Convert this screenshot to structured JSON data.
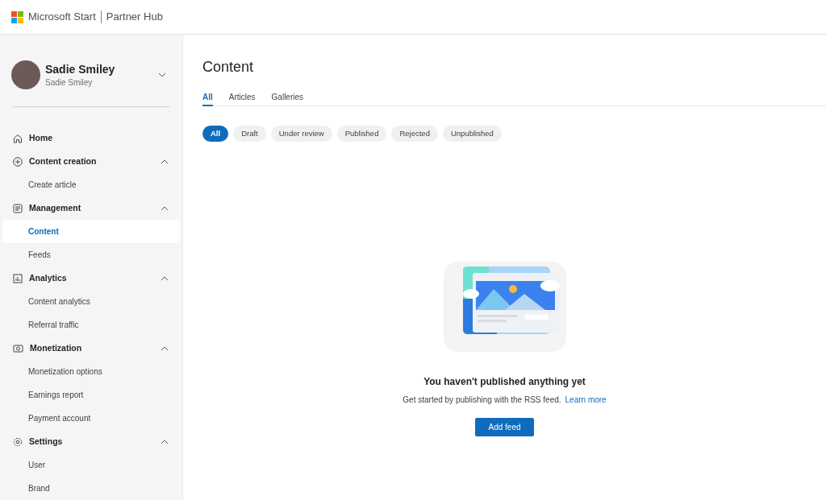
{
  "header": {
    "brand": "Microsoft Start",
    "product": "Partner Hub"
  },
  "profile": {
    "name": "Sadie Smiley",
    "subtitle": "Sadie Smiley",
    "expanded": false
  },
  "nav": [
    {
      "kind": "link",
      "label": "Home",
      "selected": false
    },
    {
      "kind": "group",
      "label": "Content creation",
      "selected": false,
      "expanded": true,
      "children": [
        {
          "label": "Create article",
          "selected": false
        }
      ]
    },
    {
      "kind": "group",
      "label": "Management",
      "selected": false,
      "expanded": true,
      "children": [
        {
          "label": "Content",
          "selected": true
        },
        {
          "label": "Feeds",
          "selected": false
        }
      ]
    },
    {
      "kind": "group",
      "label": "Analytics",
      "selected": false,
      "expanded": true,
      "children": [
        {
          "label": "Content analytics",
          "selected": false
        },
        {
          "label": "Referral traffic",
          "selected": false
        }
      ]
    },
    {
      "kind": "group",
      "label": "Monetization",
      "selected": false,
      "expanded": true,
      "children": [
        {
          "label": "Monetization options",
          "selected": false
        },
        {
          "label": "Earnings report",
          "selected": false
        },
        {
          "label": "Payment account",
          "selected": false
        }
      ]
    },
    {
      "kind": "group",
      "label": "Settings",
      "selected": false,
      "expanded": true,
      "children": [
        {
          "label": "User",
          "selected": false
        },
        {
          "label": "Brand",
          "selected": false
        }
      ]
    }
  ],
  "page_title": "Content",
  "tabs": [
    {
      "label": "All",
      "selected": true
    },
    {
      "label": "Articles",
      "selected": false
    },
    {
      "label": "Galleries",
      "selected": false
    }
  ],
  "filters": [
    {
      "label": "All",
      "selected": true
    },
    {
      "label": "Draft",
      "selected": false
    },
    {
      "label": "Under review",
      "selected": false
    },
    {
      "label": "Published",
      "selected": false
    },
    {
      "label": "Rejected",
      "selected": false
    },
    {
      "label": "Unpublished",
      "selected": false
    }
  ],
  "empty_state": {
    "heading": "You haven't published anything yet",
    "message": "Get started by publishing with the RSS feed.",
    "link": "Learn more",
    "button": "Add feed"
  }
}
